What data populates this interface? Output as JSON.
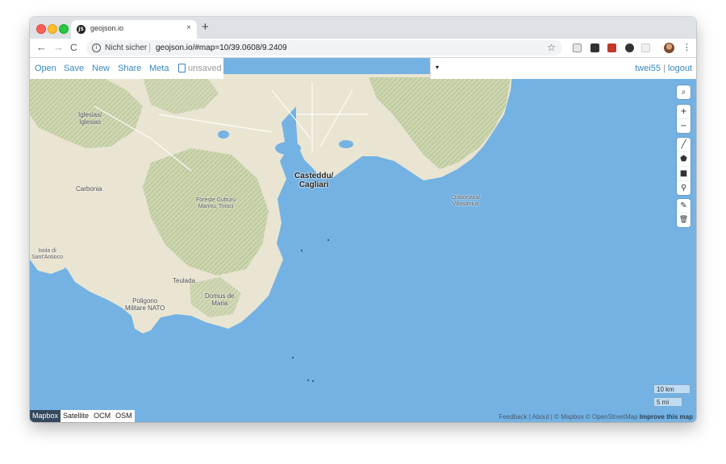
{
  "browser": {
    "tab_title": "geojson.io",
    "tab_favicon_text": "JS",
    "tab_close": "×",
    "new_tab": "+",
    "nav": {
      "back": "←",
      "forward": "→",
      "reload": "C"
    },
    "security_text": "Nicht sicher",
    "url": "geojson.io/#map=10/39.0608/9.2409",
    "star": "☆",
    "menu": "⋮"
  },
  "app": {
    "menu": {
      "open": "Open",
      "save": "Save",
      "new": "New",
      "share": "Share",
      "meta": "Meta",
      "status": "unsaved"
    },
    "user": {
      "name": "twei55",
      "separator": "|",
      "logout": "logout"
    },
    "caret": "▾"
  },
  "map": {
    "place_labels": {
      "iglesias": "Iglesias/\nIglesias",
      "carbonia": "Carbonia",
      "casteddu": "Casteddu/\nCagliari",
      "foreste": "Foreste Gutturu\nMannu, Tirioci",
      "sant_antioco": "Isola di\nSant'Antioco",
      "teulada": "Teulada",
      "poligono": "Poligono\nMilitare NATO",
      "domus": "Domus de\nMaria",
      "crabonaxa": "Crabonaxa/\nVillasimius"
    },
    "controls": {
      "search": "⌕",
      "zoom_in": "+",
      "zoom_out": "−",
      "line": "╱",
      "polygon": "⬟",
      "rectangle": "■",
      "marker": "⚲",
      "edit": "✎",
      "delete": "🗑"
    },
    "layers": [
      "Mapbox",
      "Satellite",
      "OCM",
      "OSM"
    ],
    "active_layer": "Mapbox",
    "scale": {
      "km": "10 km",
      "mi": "5 mi"
    },
    "attribution": {
      "feedback": "Feedback",
      "about": "About",
      "mapbox": "© Mapbox",
      "osm": "© OpenStreetMap",
      "improve": "Improve this map",
      "sep": "|"
    },
    "colors": {
      "water": "#73b2e3",
      "land": "#e9e5d2",
      "hills": "#c5d2a8",
      "link": "#3887be"
    }
  }
}
